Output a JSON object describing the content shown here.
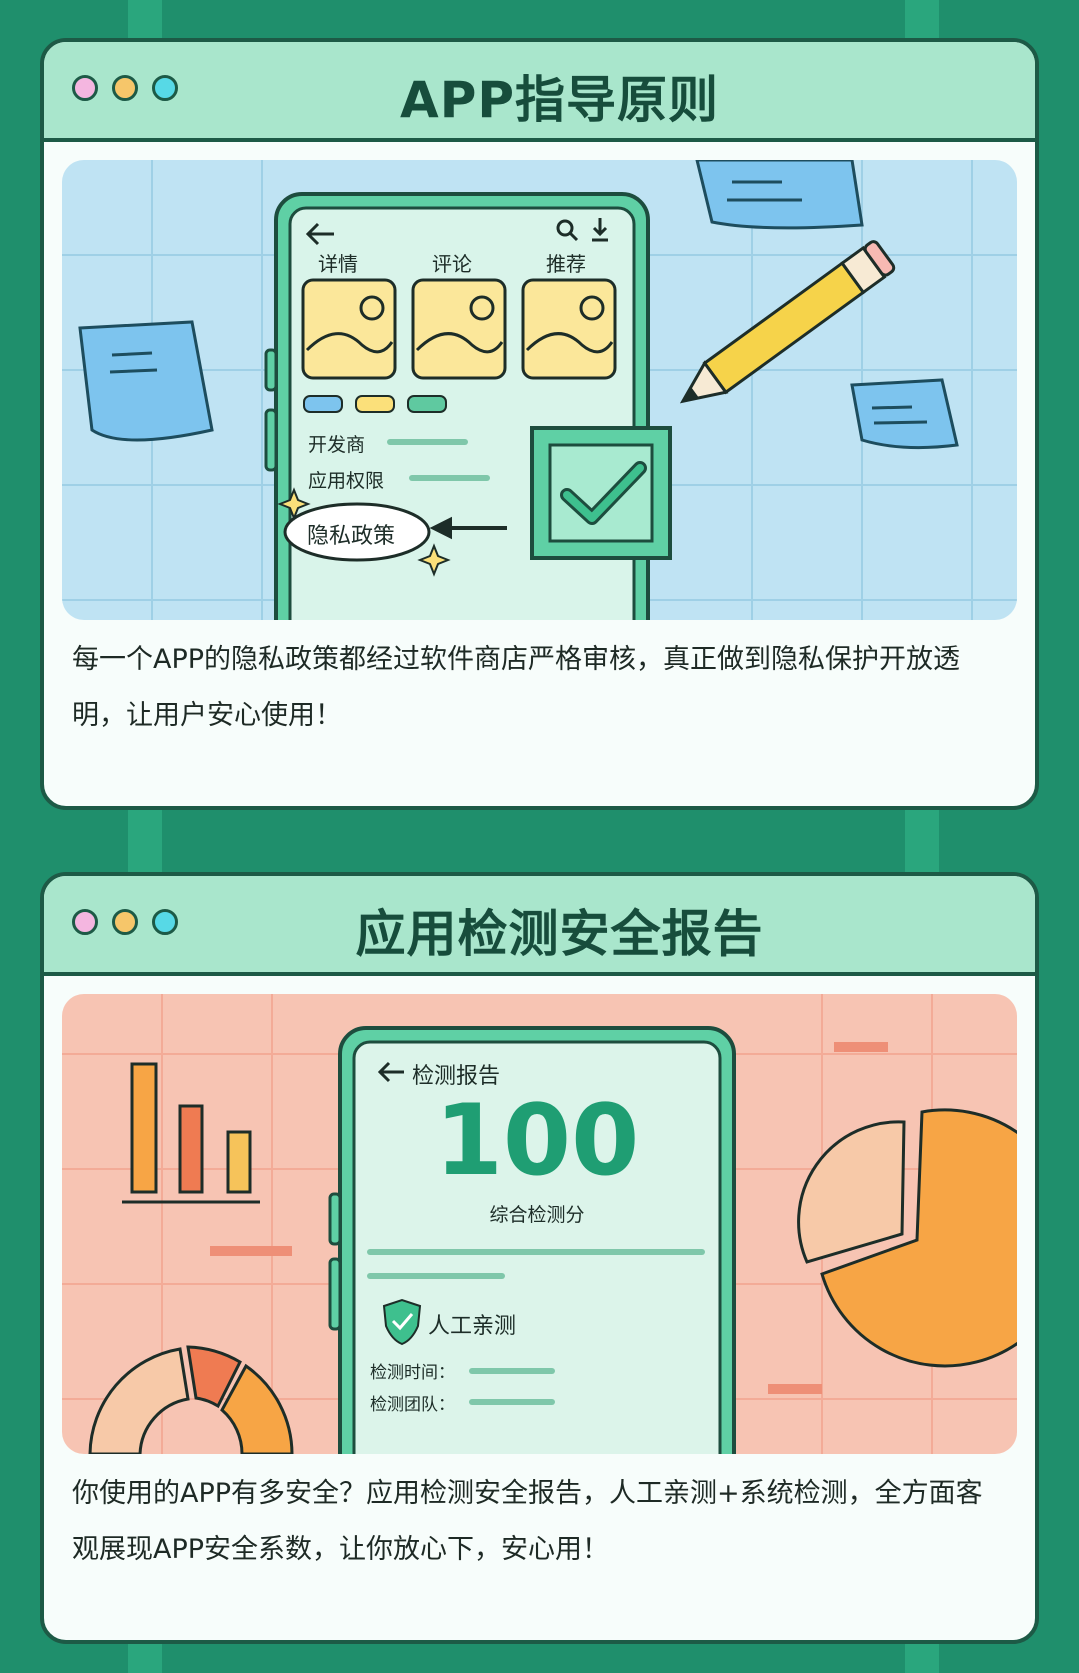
{
  "card1": {
    "title": "APP指导原则",
    "phone": {
      "tabs": [
        "详情",
        "评论",
        "推荐"
      ],
      "rows": [
        "开发商",
        "应用权限"
      ],
      "policy_label": "隐私政策"
    },
    "description": "每一个APP的隐私政策都经过软件商店严格审核，真正做到隐私保护开放透明，让用户安心使用！"
  },
  "card2": {
    "title": "应用检测安全报告",
    "phone": {
      "header": "检测报告",
      "score": "100",
      "score_label": "综合检测分",
      "badge": "人工亲测",
      "rows": [
        "检测时间：",
        "检测团队："
      ]
    },
    "description": "你使用的APP有多安全？应用检测安全报告，人工亲测+系统检测，全方面客观展现APP安全系数，让你放心下，安心用！"
  },
  "colors": {
    "background": "#1f8f6c",
    "header": "#a9e6cc",
    "dot_pink": "#f4b6e0",
    "dot_yellow": "#f6c66a",
    "dot_cyan": "#57d9e6",
    "illus1_bg": "#bfe3f3",
    "illus2_bg": "#f7c4b3",
    "score_green": "#1f9e73"
  },
  "icons": [
    "back-arrow-icon",
    "search-icon",
    "download-icon",
    "image-placeholder-icon",
    "checkmark-icon",
    "pencil-icon",
    "shield-check-icon",
    "bar-chart-icon",
    "pie-chart-icon",
    "donut-chart-icon",
    "sparkle-icon"
  ]
}
